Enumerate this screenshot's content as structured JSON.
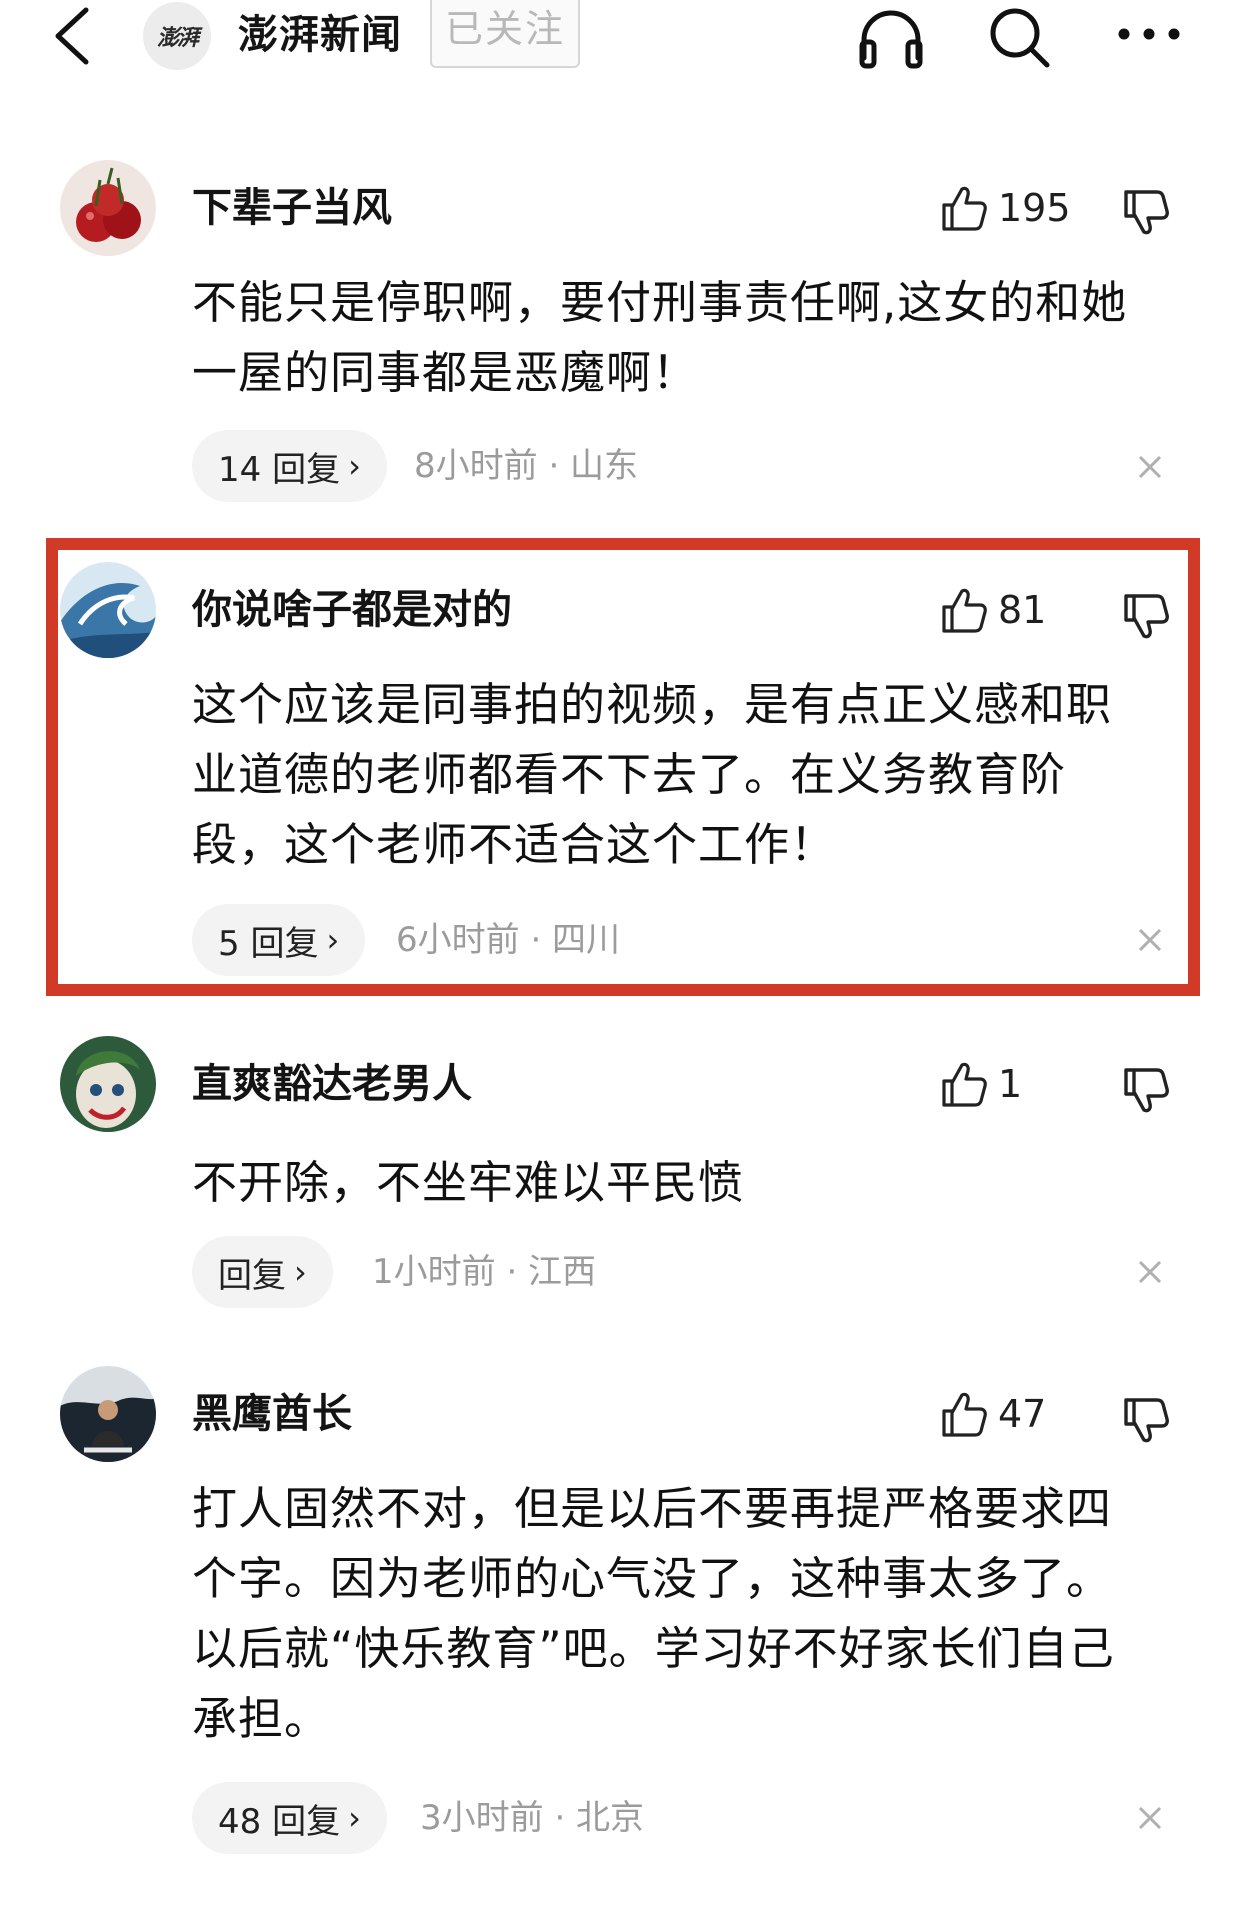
{
  "header": {
    "back_icon": "chevron-left-icon",
    "source_logo_text": "澎湃",
    "source_name": "澎湃新闻",
    "follow_label": "已关注",
    "icons": [
      "headphones-icon",
      "search-icon",
      "more-icon"
    ]
  },
  "colors": {
    "highlight_border": "#d23a28",
    "meta_text": "#9b9b9b",
    "reply_pill_bg": "#f3f3f3"
  },
  "comments": [
    {
      "username": "下辈子当风",
      "likes": "195",
      "text_lines": [
        "不能只是停职啊，要付刑事责任啊,这女的和她",
        "一屋的同事都是恶魔啊！"
      ],
      "reply_label": "14 回复",
      "meta": "8小时前 · 山东",
      "highlighted": false
    },
    {
      "username": "你说啥子都是对的",
      "likes": "81",
      "text_lines": [
        "这个应该是同事拍的视频，是有点正义感和职",
        "业道德的老师都看不下去了。在义务教育阶",
        "段，这个老师不适合这个工作！"
      ],
      "reply_label": "5 回复",
      "meta": "6小时前 · 四川",
      "highlighted": true
    },
    {
      "username": "直爽豁达老男人",
      "likes": "1",
      "text_lines": [
        "不开除，不坐牢难以平民愤"
      ],
      "reply_label": "回复",
      "meta": "1小时前 · 江西",
      "highlighted": false
    },
    {
      "username": "黑鹰酋长",
      "likes": "47",
      "text_lines": [
        "打人固然不对，但是以后不要再提严格要求四",
        "个字。因为老师的心气没了，这种事太多了。",
        "以后就“快乐教育”吧。学习好不好家长们自己",
        "承担。"
      ],
      "reply_label": "48 回复",
      "meta": "3小时前 · 北京",
      "highlighted": false
    }
  ]
}
